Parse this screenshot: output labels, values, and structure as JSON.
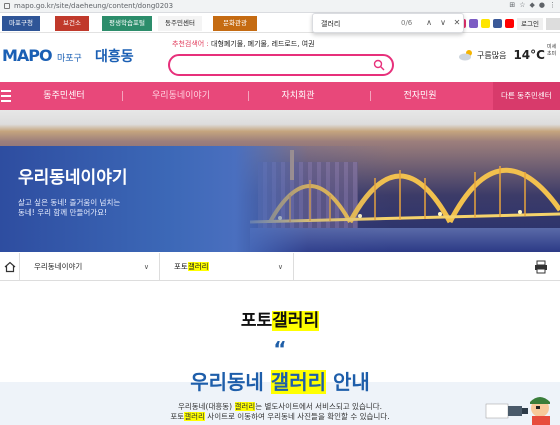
{
  "browser": {
    "url": "mapo.go.kr/site/daeheung/content/dong0203",
    "find": {
      "query": "갤러리",
      "count": "0/6"
    }
  },
  "quick_tabs": [
    {
      "label": "마포구청",
      "color": "#2f5597"
    },
    {
      "label": "보건소",
      "color": "#c0392b"
    },
    {
      "label": "평생학습포털",
      "color": "#2c8d6b"
    },
    {
      "label": "동주민센터",
      "color": "#f4f4f4"
    },
    {
      "label": "문화관광",
      "color": "#c56b12"
    }
  ],
  "util": {
    "login": "로그인"
  },
  "header": {
    "logo_text": "MAPO",
    "logo_sub": "마포구",
    "dong_name": "대흥동",
    "recommend_label": "추천검색어 :",
    "recommend_terms": "대형폐기물, 폐기물, 레드로드, 여권",
    "search_placeholder": "",
    "weather_desc": "구름많음",
    "temp": "14°C",
    "misc1": "미세",
    "misc2": "초미"
  },
  "nav": {
    "items": [
      "동주민센터",
      "우리동네이야기",
      "자치회관",
      "전자민원"
    ],
    "other": "다른 동주민센터"
  },
  "banner": {
    "title": "우리동네이야기",
    "line1": "살고 싶은 동네! 즐거움이 넘치는",
    "line2": "동네! 우리 함께 만들어가요!"
  },
  "breadcrumb": {
    "level1": "우리동네이야기",
    "level2_pre": "포토",
    "level2_hl": "갤러리"
  },
  "content": {
    "title_pre": "포토",
    "title_hl": "갤러리",
    "quote_mark": "“",
    "heading_pre": "우리동네 ",
    "heading_hl": "갤러리",
    "heading_post": " 안내",
    "desc1_pre": "우리동네(대흥동) ",
    "desc1_hl": "갤러리",
    "desc1_post": "는 별도사이트에서 서비스되고 있습니다.",
    "desc2_pre": "포토",
    "desc2_hl": "갤러리",
    "desc2_post": " 사이트로 이동하여 우리동네 사진들을 확인할 수 있습니다."
  },
  "colors": {
    "accent": "#e8487a",
    "brand_blue": "#1a5fb4",
    "highlight": "#ffff00"
  }
}
